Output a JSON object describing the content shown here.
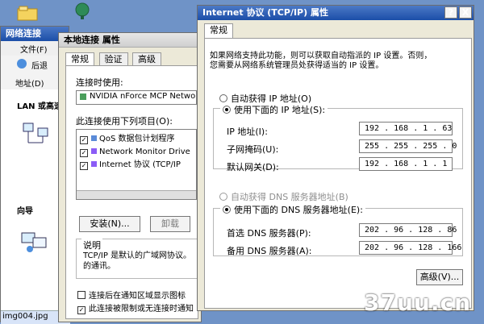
{
  "background_window": {
    "title": "网络连接",
    "menu_file": "文件(F)",
    "back_button": "后退",
    "address_label": "地址(D)",
    "lan_label": "LAN 或高速",
    "wizard_label": "向导",
    "bottom_file": "img004.jpg"
  },
  "local_connection_window": {
    "title": "本地连接 属性",
    "tabs": [
      "常规",
      "验证",
      "高级"
    ],
    "connect_using_label": "连接时使用:",
    "adapter_text": "NVIDIA nForce MCP Netwo",
    "components_label": "此连接使用下列项目(O):",
    "components": [
      "QoS 数据包计划程序",
      "Network Monitor Drive",
      "Internet 协议 (TCP/IP"
    ],
    "install_button": "安装(N)...",
    "uninstall_button": "卸载",
    "description_label": "说明",
    "description_text": "TCP/IP 是默认的广域网协议。它提供跨越多种互联网络的通讯。",
    "description_line1": "TCP/IP 是默认的广域网协议。",
    "description_line2": "的通讯。",
    "show_icon_text": "连接后在通知区域显示图标",
    "notify_text": "此连接被限制或无连接时通知"
  },
  "tcpip_window": {
    "title": "Internet 协议 (TCP/IP) 属性",
    "help_button": "?",
    "close_button": "X",
    "tab": "常规",
    "intro_line1": "如果网络支持此功能，则可以获取自动指派的 IP 设置。否则，",
    "intro_line2": "您需要从网络系统管理员处获得适当的 IP 设置。",
    "auto_ip_label": "自动获得 IP 地址(O)",
    "manual_ip_label": "使用下面的 IP 地址(S):",
    "ip_label": "IP 地址(I):",
    "subnet_label": "子网掩码(U):",
    "gateway_label": "默认网关(D):",
    "ip_value": "192 . 168 . 1 . 63",
    "subnet_value": "255 . 255 . 255 . 0",
    "gateway_value": "192 . 168 . 1 . 1",
    "auto_dns_label": "自动获得 DNS 服务器地址(B)",
    "manual_dns_label": "使用下面的 DNS 服务器地址(E):",
    "preferred_dns_label": "首选 DNS 服务器(P):",
    "alternate_dns_label": "备用 DNS 服务器(A):",
    "preferred_dns_value": "202 . 96 . 128 . 86",
    "alternate_dns_value": "202 . 96 . 128 . 166",
    "advanced_button": "高级(V)..."
  },
  "watermark": {
    "text": "37uu.cn"
  },
  "colors": {
    "desktop": "#6f93c7",
    "titlebar": "#1b4ea8",
    "window_bg": "#ece9d8"
  }
}
